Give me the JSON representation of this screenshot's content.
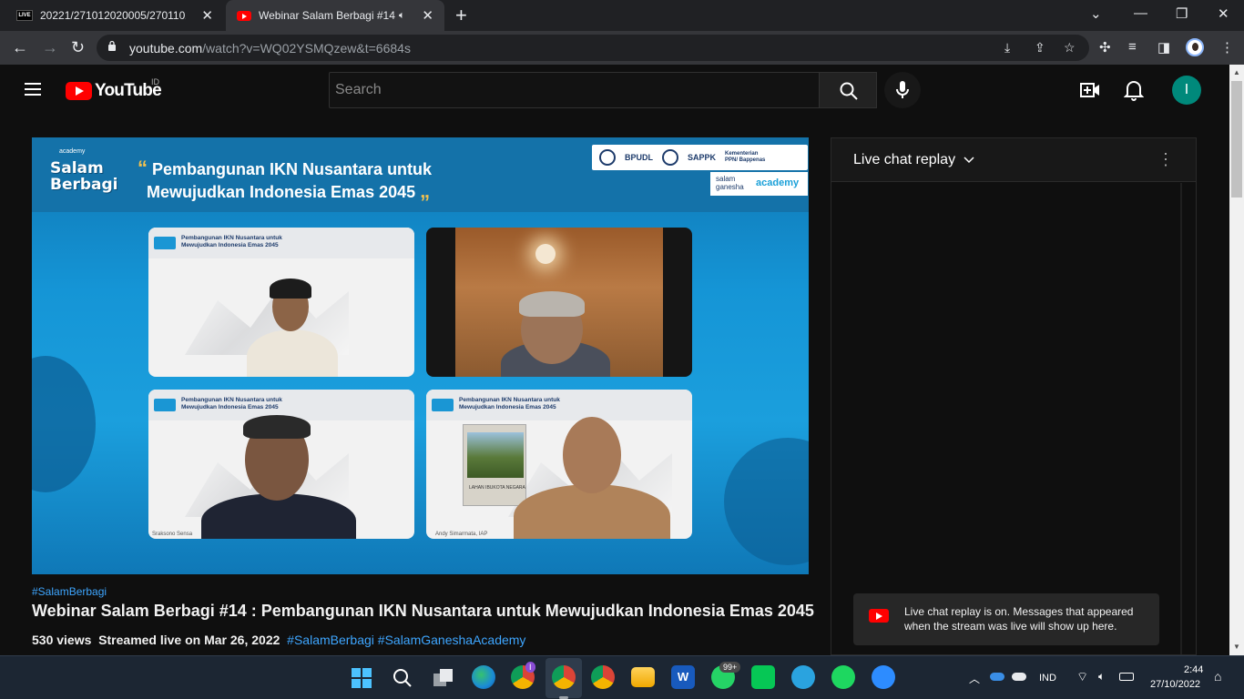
{
  "browser": {
    "tabs": [
      {
        "title": "20221/271012020005/27011020...",
        "favicon": "live-icon",
        "active": false
      },
      {
        "title": "Webinar Salam Berbagi #14 :",
        "favicon": "youtube-icon",
        "active": true
      }
    ],
    "url_host": "youtube.com",
    "url_path": "/watch?v=WQ02YSMQzew&t=6684s"
  },
  "youtube": {
    "logo_text": "YouTube",
    "country_code": "ID",
    "search_placeholder": "Search",
    "account_initial": "I"
  },
  "video_overlay": {
    "logo_academy": "academy",
    "logo_line1": "Salam",
    "logo_line2": "Berbagi",
    "headline_line1": "Pembangunan IKN Nusantara untuk",
    "headline_line2": "Mewujudkan Indonesia Emas 2045",
    "partners": [
      "BPUDL",
      "SAPPK",
      "Kementerian PPN/ Bappenas"
    ],
    "partner2_line1": "salam",
    "partner2_line2": "ganesha",
    "partner2_brand": "academy",
    "panel_slide_title_line1": "Pembangunan IKN Nusantara untuk",
    "panel_slide_title_line2": "Mewujudkan Indonesia Emas 2045",
    "panel3_name": "Sraksono Sensa",
    "panel4_name": "Andy Simarmata, IAP",
    "book_title": "LAHAN IBUKOTA NEGARA"
  },
  "video_info": {
    "hashtag": "#SalamBerbagi",
    "title": "Webinar Salam Berbagi #14 : Pembangunan IKN Nusantara untuk Mewujudkan Indonesia Emas 2045",
    "views": "530 views",
    "streamed": "Streamed live on Mar 26, 2022",
    "tags": "#SalamBerbagi #SalamGaneshaAcademy"
  },
  "chat": {
    "title": "Live chat replay",
    "notice": "Live chat replay is on. Messages that appeared when the stream was live will show up here."
  },
  "taskbar": {
    "language": "IND",
    "time": "2:44",
    "date": "27/10/2022",
    "whatsapp_badge": "99+",
    "chrome_badge": "I"
  },
  "colors": {
    "accent": "#3ea6ff",
    "youtube_red": "#ff0000",
    "avatar": "#00897b"
  }
}
